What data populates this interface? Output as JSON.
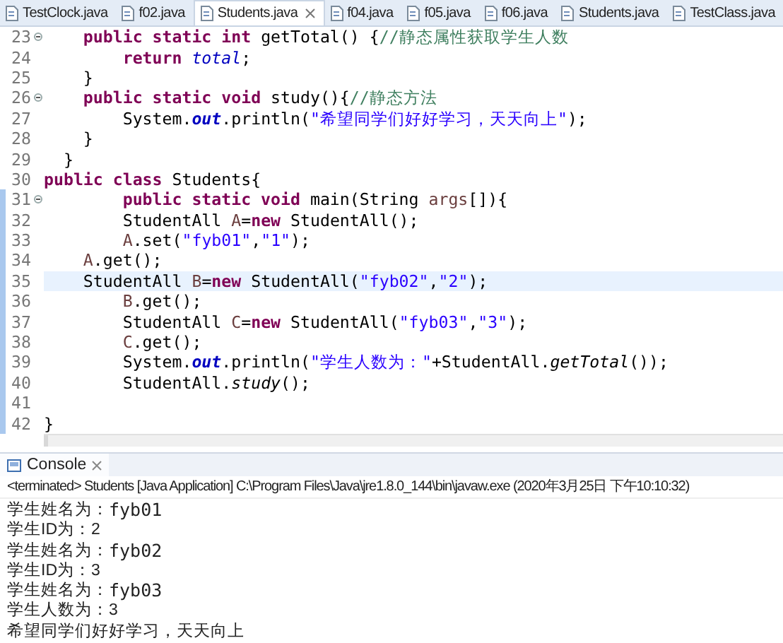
{
  "tabs": [
    {
      "label": "TestClock.java",
      "selected": false
    },
    {
      "label": "f02.java",
      "selected": false
    },
    {
      "label": "Students.java",
      "selected": true
    },
    {
      "label": "f04.java",
      "selected": false
    },
    {
      "label": "f05.java",
      "selected": false
    },
    {
      "label": "f06.java",
      "selected": false
    },
    {
      "label": "Students.java",
      "selected": false
    },
    {
      "label": "TestClass.java",
      "selected": false
    }
  ],
  "editor": {
    "lines": [
      {
        "number": "23",
        "fold": true,
        "ranged": false,
        "current": false,
        "tokens": [
          {
            "kind": "kw",
            "t": "    public static int"
          },
          {
            "kind": "plain",
            "t": " getTotal() {"
          },
          {
            "kind": "comment",
            "t": "//静态属性获取学生人数"
          }
        ]
      },
      {
        "number": "24",
        "fold": false,
        "ranged": false,
        "current": false,
        "tokens": [
          {
            "kind": "kw",
            "t": "        return "
          },
          {
            "kind": "field",
            "t": "total"
          },
          {
            "kind": "plain",
            "t": ";"
          }
        ]
      },
      {
        "number": "25",
        "fold": false,
        "ranged": false,
        "current": false,
        "tokens": [
          {
            "kind": "plain",
            "t": "    }"
          }
        ]
      },
      {
        "number": "26",
        "fold": true,
        "ranged": false,
        "current": false,
        "tokens": [
          {
            "kind": "kw",
            "t": "    public static void"
          },
          {
            "kind": "plain",
            "t": " study(){"
          },
          {
            "kind": "comment",
            "t": "//静态方法"
          }
        ]
      },
      {
        "number": "27",
        "fold": false,
        "ranged": false,
        "current": false,
        "tokens": [
          {
            "kind": "plain",
            "t": "        System."
          },
          {
            "kind": "sfield",
            "t": "out"
          },
          {
            "kind": "plain",
            "t": ".println("
          },
          {
            "kind": "string",
            "t": "\"希望同学们好好学习，天天向上\""
          },
          {
            "kind": "plain",
            "t": ");"
          }
        ]
      },
      {
        "number": "28",
        "fold": false,
        "ranged": false,
        "current": false,
        "tokens": [
          {
            "kind": "plain",
            "t": "    }"
          }
        ]
      },
      {
        "number": "29",
        "fold": false,
        "ranged": false,
        "current": false,
        "tokens": [
          {
            "kind": "plain",
            "t": "  }"
          }
        ]
      },
      {
        "number": "30",
        "fold": false,
        "ranged": false,
        "current": false,
        "tokens": [
          {
            "kind": "kw",
            "t": "public class"
          },
          {
            "kind": "plain",
            "t": " Students{"
          }
        ]
      },
      {
        "number": "31",
        "fold": true,
        "ranged": true,
        "current": false,
        "tokens": [
          {
            "kind": "kw",
            "t": "        public static void"
          },
          {
            "kind": "plain",
            "t": " main(String "
          },
          {
            "kind": "var",
            "t": "args"
          },
          {
            "kind": "plain",
            "t": "[]){"
          }
        ]
      },
      {
        "number": "32",
        "fold": false,
        "ranged": true,
        "current": false,
        "tokens": [
          {
            "kind": "plain",
            "t": "        StudentAll "
          },
          {
            "kind": "var",
            "t": "A"
          },
          {
            "kind": "plain",
            "t": "="
          },
          {
            "kind": "kw",
            "t": "new"
          },
          {
            "kind": "plain",
            "t": " StudentAll();"
          }
        ]
      },
      {
        "number": "33",
        "fold": false,
        "ranged": true,
        "current": false,
        "tokens": [
          {
            "kind": "var",
            "t": "        A"
          },
          {
            "kind": "plain",
            "t": ".set("
          },
          {
            "kind": "string",
            "t": "\"fyb01\""
          },
          {
            "kind": "plain",
            "t": ","
          },
          {
            "kind": "string",
            "t": "\"1\""
          },
          {
            "kind": "plain",
            "t": ");"
          }
        ]
      },
      {
        "number": "34",
        "fold": false,
        "ranged": true,
        "current": false,
        "tokens": [
          {
            "kind": "var",
            "t": "    A"
          },
          {
            "kind": "plain",
            "t": ".get();"
          }
        ]
      },
      {
        "number": "35",
        "fold": false,
        "ranged": true,
        "current": true,
        "tokens": [
          {
            "kind": "plain",
            "t": "    StudentAll "
          },
          {
            "kind": "var",
            "t": "B"
          },
          {
            "kind": "plain",
            "t": "="
          },
          {
            "kind": "kw",
            "t": "new"
          },
          {
            "kind": "plain",
            "t": " StudentAll("
          },
          {
            "kind": "string",
            "t": "\"fyb02\""
          },
          {
            "kind": "plain",
            "t": ","
          },
          {
            "kind": "string",
            "t": "\"2\""
          },
          {
            "kind": "plain",
            "t": ");"
          }
        ]
      },
      {
        "number": "36",
        "fold": false,
        "ranged": true,
        "current": false,
        "tokens": [
          {
            "kind": "var",
            "t": "        B"
          },
          {
            "kind": "plain",
            "t": ".get();"
          }
        ]
      },
      {
        "number": "37",
        "fold": false,
        "ranged": true,
        "current": false,
        "tokens": [
          {
            "kind": "plain",
            "t": "        StudentAll "
          },
          {
            "kind": "var",
            "t": "C"
          },
          {
            "kind": "plain",
            "t": "="
          },
          {
            "kind": "kw",
            "t": "new"
          },
          {
            "kind": "plain",
            "t": " StudentAll("
          },
          {
            "kind": "string",
            "t": "\"fyb03\""
          },
          {
            "kind": "plain",
            "t": ","
          },
          {
            "kind": "string",
            "t": "\"3\""
          },
          {
            "kind": "plain",
            "t": ");"
          }
        ]
      },
      {
        "number": "38",
        "fold": false,
        "ranged": true,
        "current": false,
        "tokens": [
          {
            "kind": "var",
            "t": "        C"
          },
          {
            "kind": "plain",
            "t": ".get();"
          }
        ]
      },
      {
        "number": "39",
        "fold": false,
        "ranged": true,
        "current": false,
        "tokens": [
          {
            "kind": "plain",
            "t": "        System."
          },
          {
            "kind": "sfield",
            "t": "out"
          },
          {
            "kind": "plain",
            "t": ".println("
          },
          {
            "kind": "string",
            "t": "\"学生人数为：\""
          },
          {
            "kind": "plain",
            "t": "+StudentAll."
          },
          {
            "kind": "smethod",
            "t": "getTotal"
          },
          {
            "kind": "plain",
            "t": "());"
          }
        ]
      },
      {
        "number": "40",
        "fold": false,
        "ranged": true,
        "current": false,
        "tokens": [
          {
            "kind": "plain",
            "t": "        StudentAll."
          },
          {
            "kind": "smethod",
            "t": "study"
          },
          {
            "kind": "plain",
            "t": "();"
          }
        ]
      },
      {
        "number": "41",
        "fold": false,
        "ranged": true,
        "current": false
      },
      {
        "number": "42",
        "fold": false,
        "ranged": true,
        "current": false,
        "tokens": [
          {
            "kind": "plain",
            "t": "}"
          }
        ]
      }
    ]
  },
  "console": {
    "tab": {
      "label": "Console",
      "selected": true
    },
    "header": "<terminated> Students [Java Application] C:\\Program Files\\Java\\jre1.8.0_144\\bin\\javaw.exe (2020年3月25日 下午10:10:32)",
    "output": [
      {
        "label": "学生姓名为：",
        "value": "fyb01"
      },
      {
        "label": "学生ID为：2"
      },
      {
        "label": "学生姓名为：",
        "value": "fyb02"
      },
      {
        "label": "学生ID为：3"
      },
      {
        "label": "学生姓名为：",
        "value": "fyb03"
      },
      {
        "label": "学生人数为：3"
      },
      {
        "label": "希望同学们好好学习，天天向上"
      }
    ]
  }
}
